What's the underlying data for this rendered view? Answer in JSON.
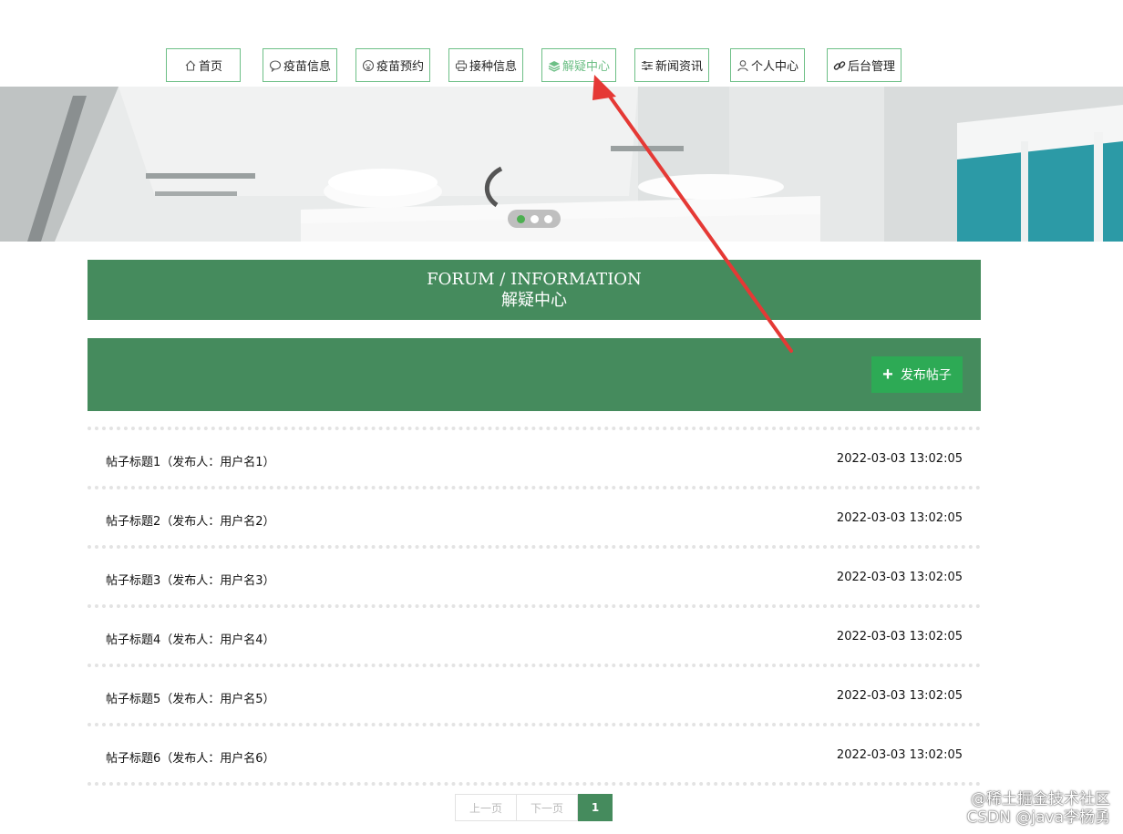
{
  "nav": {
    "items": [
      {
        "label": "首页",
        "icon": "home-icon"
      },
      {
        "label": "疫苗信息",
        "icon": "chat-bubble-icon"
      },
      {
        "label": "疫苗预约",
        "icon": "face-icon"
      },
      {
        "label": "接种信息",
        "icon": "printer-icon"
      },
      {
        "label": "解疑中心",
        "icon": "layers-icon",
        "active": true
      },
      {
        "label": "新闻资讯",
        "icon": "sliders-icon"
      },
      {
        "label": "个人中心",
        "icon": "user-icon"
      },
      {
        "label": "后台管理",
        "icon": "link-icon"
      }
    ]
  },
  "banner": {
    "slides": 3,
    "active_slide": 1
  },
  "page_header": {
    "en": "FORUM / INFORMATION",
    "cn": "解疑中心"
  },
  "toolbar": {
    "publish_label": "发布帖子"
  },
  "posts": [
    {
      "title": "帖子标题1（发布人：用户名1）",
      "time": "2022-03-03 13:02:05"
    },
    {
      "title": "帖子标题2（发布人：用户名2）",
      "time": "2022-03-03 13:02:05"
    },
    {
      "title": "帖子标题3（发布人：用户名3）",
      "time": "2022-03-03 13:02:05"
    },
    {
      "title": "帖子标题4（发布人：用户名4）",
      "time": "2022-03-03 13:02:05"
    },
    {
      "title": "帖子标题5（发布人：用户名5）",
      "time": "2022-03-03 13:02:05"
    },
    {
      "title": "帖子标题6（发布人：用户名6）",
      "time": "2022-03-03 13:02:05"
    }
  ],
  "pager": {
    "prev": "上一页",
    "next": "下一页",
    "current": "1"
  },
  "watermark": {
    "line1": "@稀土掘金技术社区",
    "line2": "CSDN @java李杨勇"
  },
  "colors": {
    "primary": "#458b5d",
    "accent": "#6dbf86",
    "button": "#2daa55",
    "arrow": "#e53935"
  }
}
